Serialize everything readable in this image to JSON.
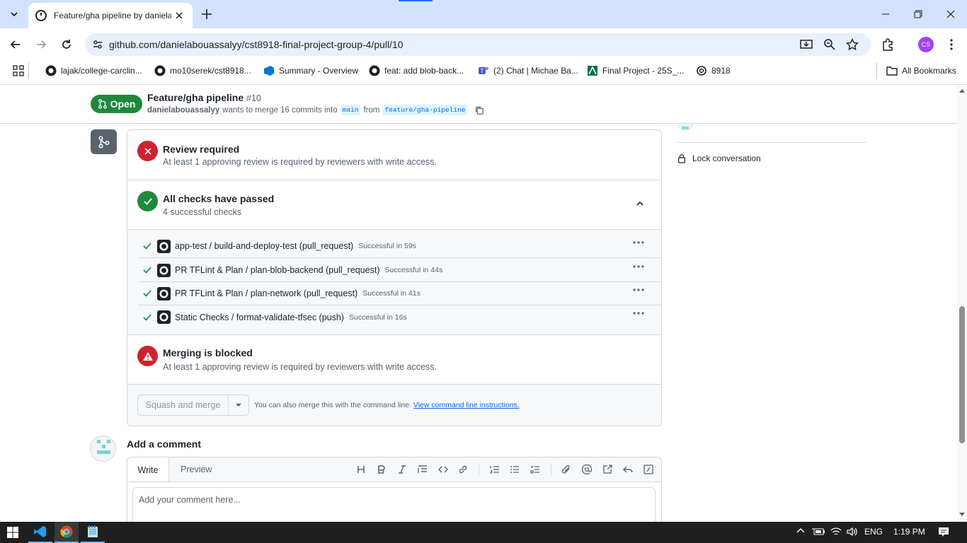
{
  "browser": {
    "tab_title": "Feature/gha pipeline by daniela",
    "url": "github.com/danielabouassalyy/cst8918-final-project-group-4/pull/10",
    "profile_initials": "CS",
    "bookmarks": [
      {
        "label": "lajak/college-carclin...",
        "icon": "github-icon"
      },
      {
        "label": "mo10serek/cst8918...",
        "icon": "github-icon"
      },
      {
        "label": "Summary - Overview",
        "icon": "azure-devops-icon"
      },
      {
        "label": "feat: add blob-back...",
        "icon": "github-icon"
      },
      {
        "label": "(2) Chat | Michae Ba...",
        "icon": "teams-icon"
      },
      {
        "label": "Final Project - 25S_...",
        "icon": "brightspace-icon"
      },
      {
        "label": "8918",
        "icon": "openai-icon"
      }
    ],
    "all_bookmarks_label": "All Bookmarks"
  },
  "pr_header": {
    "status": "Open",
    "title": "Feature/gha pipeline",
    "number": "#10",
    "author": "danielabouassalyy",
    "merge_text": "wants to merge 16 commits into",
    "base_branch": "main",
    "from_text": "from",
    "head_branch": "feature/gha-pipeline"
  },
  "sidebar": {
    "lock_label": "Lock conversation"
  },
  "merge_box": {
    "review": {
      "title": "Review required",
      "subtitle": "At least 1 approving review is required by reviewers with write access."
    },
    "checks": {
      "title": "All checks have passed",
      "subtitle": "4 successful checks"
    },
    "check_items": [
      {
        "name": "app-test / build-and-deploy-test (pull_request)",
        "status": "Successful in 59s"
      },
      {
        "name": "PR TFLint & Plan / plan-blob-backend (pull_request)",
        "status": "Successful in 44s"
      },
      {
        "name": "PR TFLint & Plan / plan-network (pull_request)",
        "status": "Successful in 41s"
      },
      {
        "name": "Static Checks / format-validate-tfsec (push)",
        "status": "Successful in 16s"
      }
    ],
    "blocked": {
      "title": "Merging is blocked",
      "subtitle": "At least 1 approving review is required by reviewers with write access."
    },
    "merge_button": "Squash and merge",
    "cli_text": "You can also merge this with the command line.",
    "cli_link": "View command line instructions."
  },
  "comment": {
    "heading": "Add a comment",
    "tab_write": "Write",
    "tab_preview": "Preview",
    "placeholder": "Add your comment here..."
  },
  "taskbar": {
    "language": "ENG",
    "time": "1:19 PM"
  },
  "colors": {
    "success": "#1f883d",
    "danger": "#cf222e",
    "link": "#0969da",
    "tabstrip": "#d3e3fd"
  }
}
